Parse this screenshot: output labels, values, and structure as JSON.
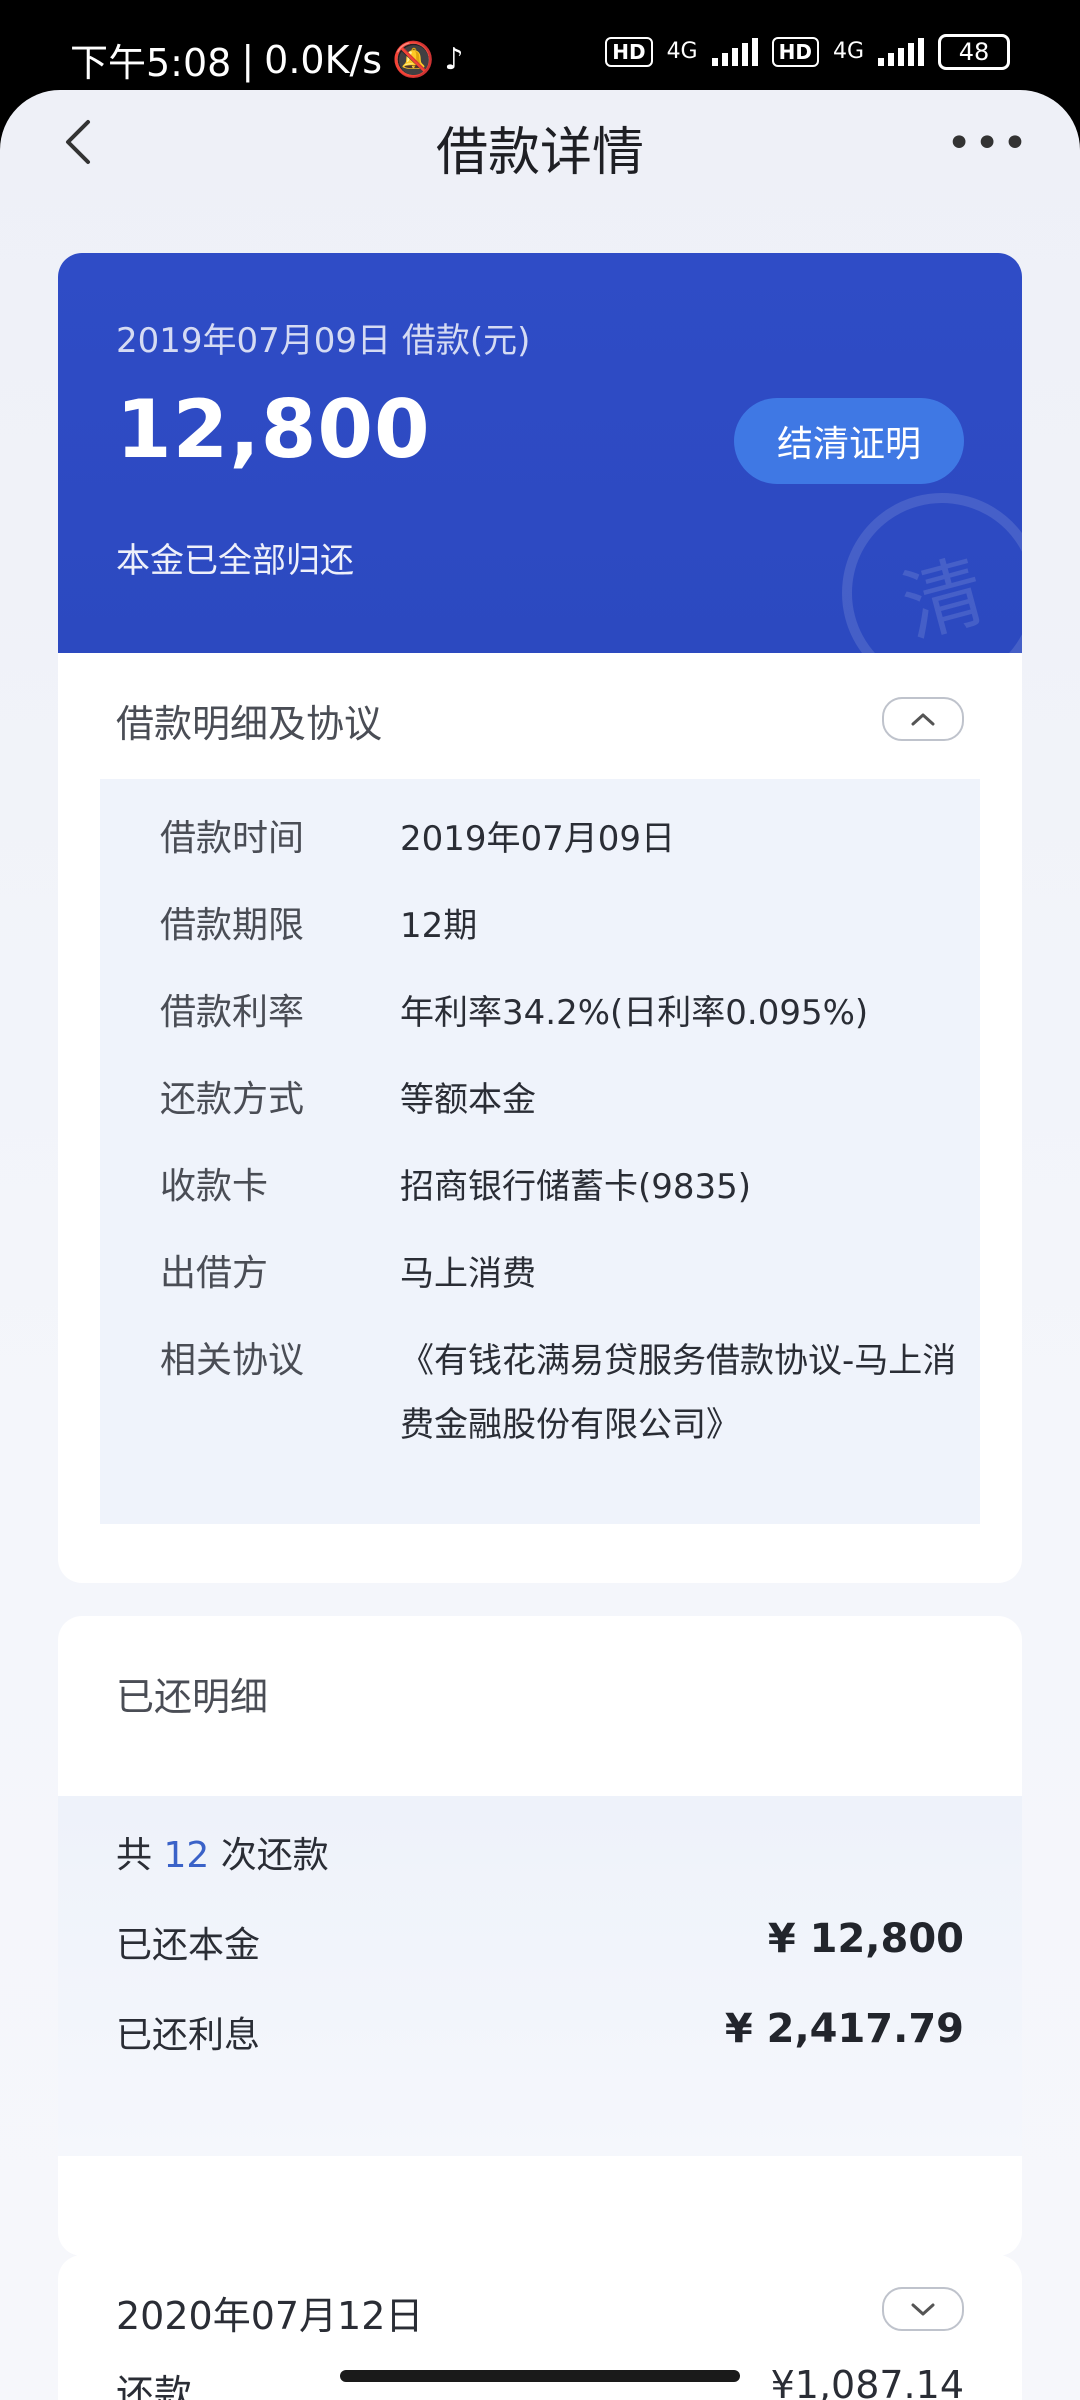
{
  "status_bar": {
    "time": "下午5:08",
    "net_speed": "0.0K/s",
    "hd1": "HD",
    "net1": "4G",
    "hd2": "HD",
    "net2": "4G",
    "battery": "48"
  },
  "header": {
    "title": "借款详情"
  },
  "summary": {
    "label": "2019年07月09日 借款(元)",
    "amount": "12,800",
    "status": "本金已全部归还",
    "settle_button": "结清证明",
    "seal_char": "清",
    "brand_color": "#2f4cc6"
  },
  "details": {
    "section_title": "借款明细及协议",
    "rows": [
      {
        "key": "借款时间",
        "value": "2019年07月09日"
      },
      {
        "key": "借款期限",
        "value": "12期"
      },
      {
        "key": "借款利率",
        "value": "年利率34.2%(日利率0.095%)"
      },
      {
        "key": "还款方式",
        "value": "等额本金"
      },
      {
        "key": "收款卡",
        "value": "招商银行储蓄卡(9835)"
      },
      {
        "key": "出借方",
        "value": "马上消费"
      },
      {
        "key": "相关协议",
        "value": "《有钱花满易贷服务借款协议-马上消费金融股份有限公司》"
      }
    ]
  },
  "repaid": {
    "title": "已还明细",
    "count_prefix": "共",
    "count": "12",
    "count_suffix": "次还款",
    "principal_label": "已还本金",
    "principal_value": "¥ 12,800",
    "interest_label": "已还利息",
    "interest_value": "¥ 2,417.79"
  },
  "installment": {
    "date": "2020年07月12日",
    "label": "还款",
    "value": "¥1,087.14"
  }
}
